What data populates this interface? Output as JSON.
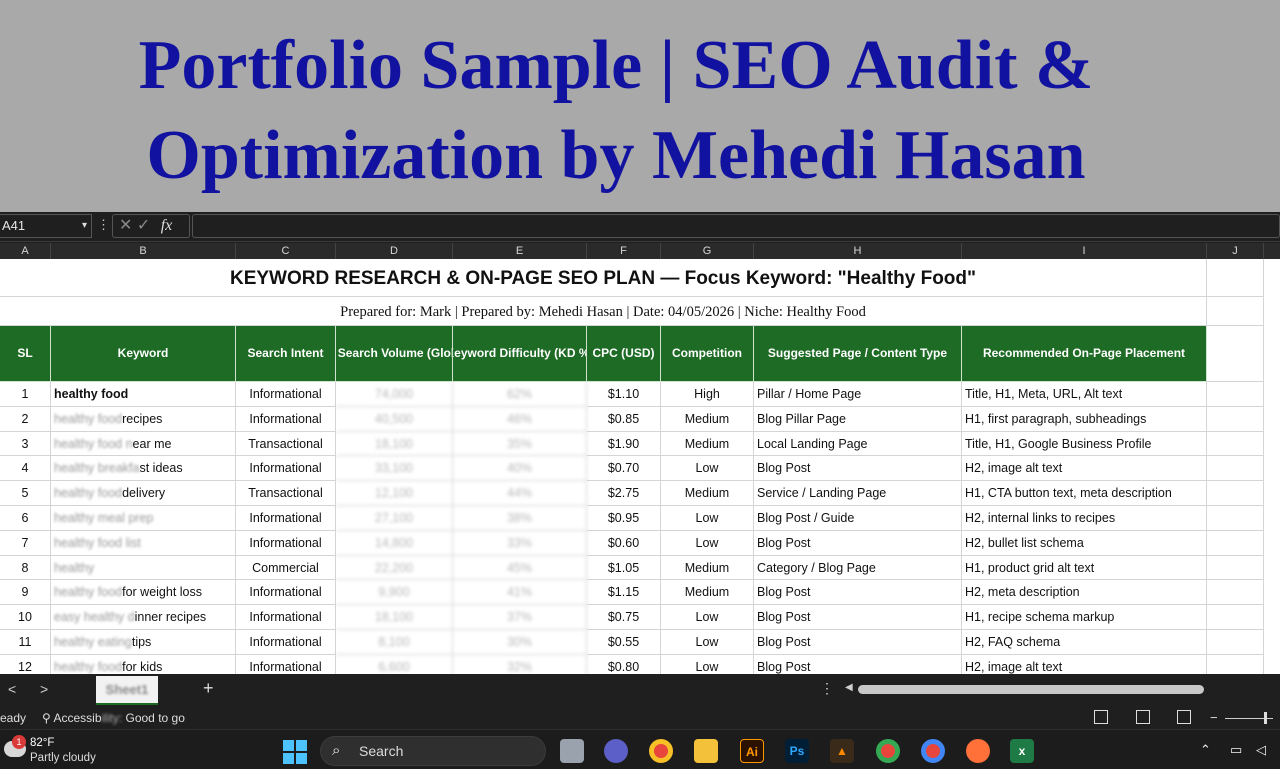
{
  "banner": {
    "line1": "Portfolio Sample | SEO Audit &",
    "line2": "Optimization by Mehedi Hasan"
  },
  "formula_bar": {
    "name_box": "A41",
    "fx": "fx",
    "cancel": "✕",
    "confirm": "✓"
  },
  "columns": [
    "A",
    "B",
    "C",
    "D",
    "E",
    "F",
    "G",
    "H",
    "I",
    "J"
  ],
  "sheet": {
    "title": "KEYWORD RESEARCH & ON-PAGE SEO PLAN — Focus Keyword: \"Healthy Food\"",
    "subtitle": "Prepared for: Mark  | Prepared by: Mehedi Hasan | Date: 04/05/2026 | Niche: Healthy Food",
    "headers": [
      "SL",
      "Keyword",
      "Search Intent",
      "Monthly Search Volume (Global, est.)",
      "Keyword Difficulty (KD %)",
      "CPC (USD)",
      "Competition",
      "Suggested Page / Content Type",
      "Recommended On-Page Placement"
    ],
    "rows": [
      {
        "sl": "1",
        "kw_a": "healthy food",
        "kw_b": "",
        "intent": "Informational",
        "volume": "74,000",
        "kd": "62%",
        "cpc": "$1.10",
        "comp": "High",
        "page": "Pillar / Home Page",
        "placement": "Title, H1, Meta, URL, Alt text"
      },
      {
        "sl": "2",
        "kw_a": "healthy food",
        "kw_b": "recipes",
        "intent": "Informational",
        "volume": "40,500",
        "kd": "46%",
        "cpc": "$0.85",
        "comp": "Medium",
        "page": "Blog Pillar Page",
        "placement": "H1, first paragraph, subheadings"
      },
      {
        "sl": "3",
        "kw_a": "healthy food n",
        "kw_b": "ear me",
        "intent": "Transactional",
        "volume": "18,100",
        "kd": "35%",
        "cpc": "$1.90",
        "comp": "Medium",
        "page": "Local Landing Page",
        "placement": "Title, H1, Google Business Profile"
      },
      {
        "sl": "4",
        "kw_a": "healthy breakfa",
        "kw_b": "st ideas",
        "intent": "Informational",
        "volume": "33,100",
        "kd": "40%",
        "cpc": "$0.70",
        "comp": "Low",
        "page": "Blog Post",
        "placement": "H2, image alt text"
      },
      {
        "sl": "5",
        "kw_a": "healthy food",
        "kw_b": "delivery",
        "intent": "Transactional",
        "volume": "12,100",
        "kd": "44%",
        "cpc": "$2.75",
        "comp": "Medium",
        "page": "Service / Landing Page",
        "placement": "H1, CTA button text, meta description"
      },
      {
        "sl": "6",
        "kw_a": "healthy meal prep",
        "kw_b": "",
        "intent": "Informational",
        "volume": "27,100",
        "kd": "38%",
        "cpc": "$0.95",
        "comp": "Low",
        "page": "Blog Post / Guide",
        "placement": "H2, internal links to recipes"
      },
      {
        "sl": "7",
        "kw_a": "healthy food list",
        "kw_b": "",
        "intent": "Informational",
        "volume": "14,800",
        "kd": "33%",
        "cpc": "$0.60",
        "comp": "Low",
        "page": "Blog Post",
        "placement": "H2, bullet list schema"
      },
      {
        "sl": "8",
        "kw_a": "healthy",
        "kw_b": "",
        "intent": "Commercial",
        "volume": "22,200",
        "kd": "45%",
        "cpc": "$1.05",
        "comp": "Medium",
        "page": "Category / Blog Page",
        "placement": "H1, product grid alt text"
      },
      {
        "sl": "9",
        "kw_a": "healthy food",
        "kw_b": "for weight loss",
        "intent": "Informational",
        "volume": "9,900",
        "kd": "41%",
        "cpc": "$1.15",
        "comp": "Medium",
        "page": "Blog Post",
        "placement": "H2, meta description"
      },
      {
        "sl": "10",
        "kw_a": "easy healthy d",
        "kw_b": "inner recipes",
        "intent": "Informational",
        "volume": "18,100",
        "kd": "37%",
        "cpc": "$0.75",
        "comp": "Low",
        "page": "Blog Post",
        "placement": "H1, recipe schema markup"
      },
      {
        "sl": "11",
        "kw_a": "healthy eating",
        "kw_b": "tips",
        "intent": "Informational",
        "volume": "8,100",
        "kd": "30%",
        "cpc": "$0.55",
        "comp": "Low",
        "page": "Blog Post",
        "placement": "H2, FAQ schema"
      },
      {
        "sl": "12",
        "kw_a": "healthy food",
        "kw_b": "for kids",
        "intent": "Informational",
        "volume": "6,600",
        "kd": "32%",
        "cpc": "$0.80",
        "comp": "Low",
        "page": "Blog Post",
        "placement": "H2, image alt text"
      }
    ]
  },
  "tabs": {
    "prev": "<",
    "next": ">",
    "active": "Sheet1",
    "add": "+"
  },
  "status": {
    "ready": "eady",
    "acc_a": "Accessib",
    "acc_b": "ility: ",
    "acc_c": "Good to go",
    "zoom_minus": "−"
  },
  "taskbar": {
    "temp": "82°F",
    "condition": "Partly cloudy",
    "badge": "1",
    "search": "Search",
    "apps": [
      "Ai",
      "Ps"
    ]
  },
  "colors": {
    "banner_bg": "#a9a9a9",
    "banner_text": "#1212a0",
    "header_green": "#1e6b25"
  }
}
